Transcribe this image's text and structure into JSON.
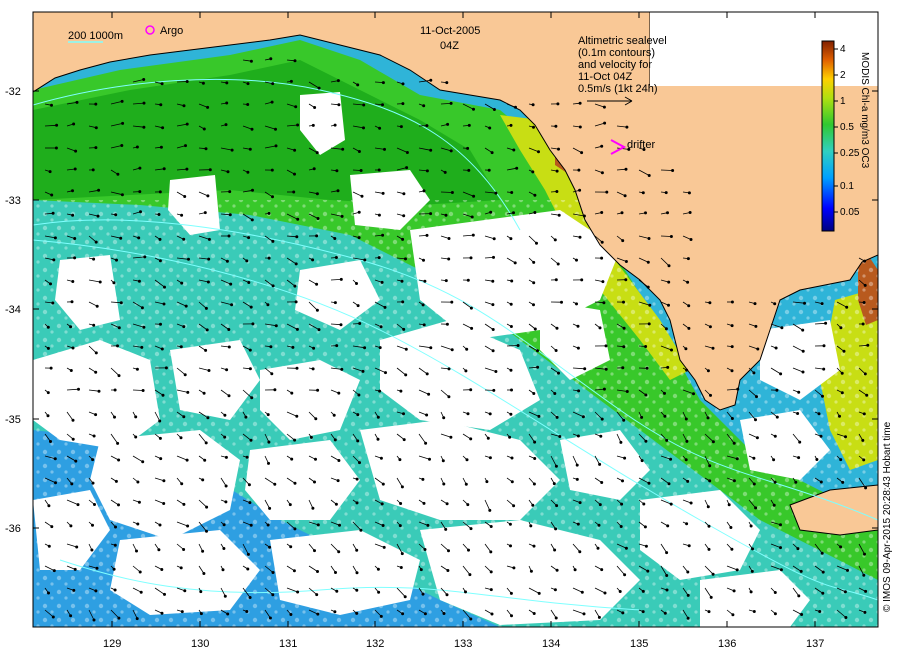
{
  "map": {
    "date": "11-Oct-2005",
    "time": "04Z",
    "scale_label": "200  1000m",
    "argo_label": "Argo",
    "drifter_label": "drifter",
    "info_lines": [
      "Altimetric sealevel",
      "(0.1m contours)",
      "and velocity for",
      "11-Oct 04Z",
      "0.5m/s (1kt 24h)"
    ],
    "colorbar_title": "MODIS Chl-a mg/m3 OC3",
    "colorbar_ticks": [
      "4",
      "2",
      "1",
      "0.5",
      "0.25",
      "0.1",
      "0.05"
    ],
    "credit": "© IMOS 09-Apr-2015 20:28:43 Hobart time",
    "lat_labels": [
      "-32",
      "-33",
      "-34",
      "-35",
      "-36"
    ],
    "lon_labels": [
      "129",
      "130",
      "131",
      "132",
      "133",
      "134",
      "135",
      "136",
      "137"
    ],
    "colors": {
      "land": "#f9c896",
      "cloud": "#ffffff",
      "chl_high": "#1db31d",
      "chl_mid": "#3fcf2e",
      "chl_low": "#35c8b4",
      "chl_vlow": "#2da6e0",
      "coast_yellow": "#d4e010",
      "coast_brown": "#b85a1e",
      "contour": "#7fffff",
      "argo": "#ff00ff",
      "drifter": "#ff00ff"
    }
  }
}
